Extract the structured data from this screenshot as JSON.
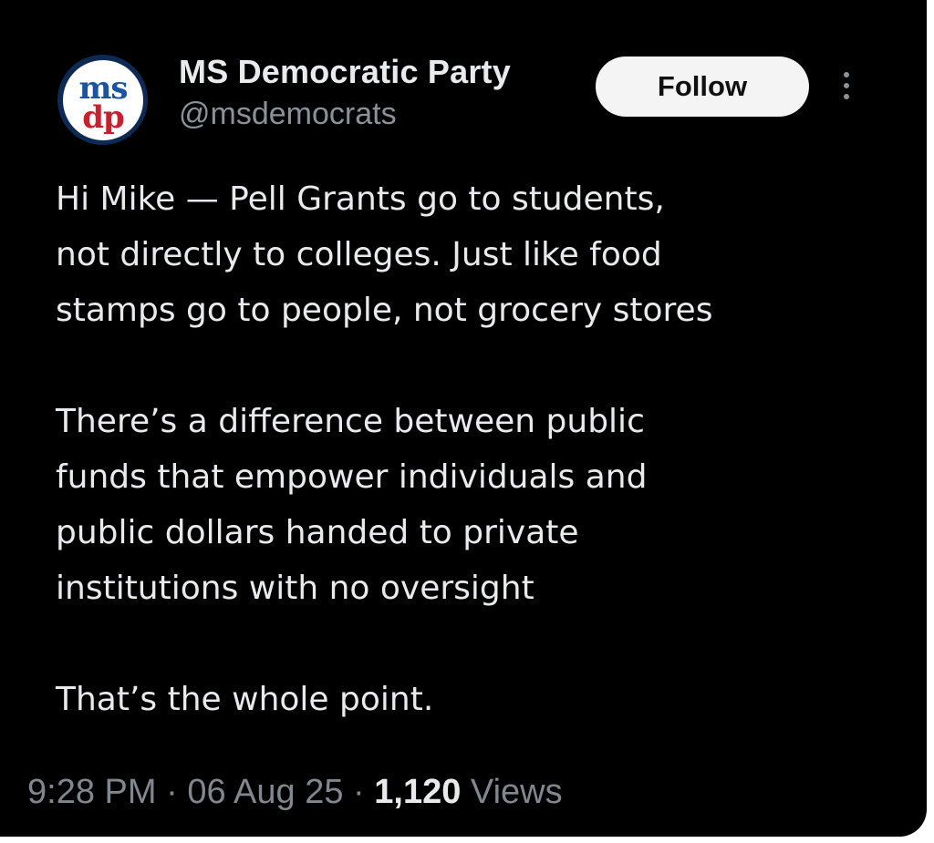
{
  "account": {
    "display_name": "MS Democratic Party",
    "handle": "@msdemocrats",
    "avatar_text_top": "ms",
    "avatar_text_bottom": "dp"
  },
  "actions": {
    "follow_label": "Follow",
    "more_icon": "more-vertical-icon"
  },
  "tweet": {
    "paragraphs": [
      [
        "Hi Mike — Pell Grants go to students,",
        "not directly to colleges. Just like food",
        "stamps go to people, not grocery stores"
      ],
      [
        "There’s a difference between public",
        "funds that empower individuals and",
        "public dollars handed to private",
        "institutions with no oversight"
      ],
      [
        "That’s the whole point."
      ]
    ]
  },
  "meta": {
    "time": "9:28 PM",
    "date": "06 Aug 25",
    "separator": "·",
    "views_count": "1,120",
    "views_label": "Views"
  },
  "colors": {
    "background": "#000000",
    "text_primary": "#e9eaeb",
    "text_secondary": "#8a9199",
    "follow_bg": "#f4f4f4",
    "logo_navy": "#0d2a55",
    "logo_red": "#c8202f",
    "logo_blue": "#1a54a3"
  }
}
